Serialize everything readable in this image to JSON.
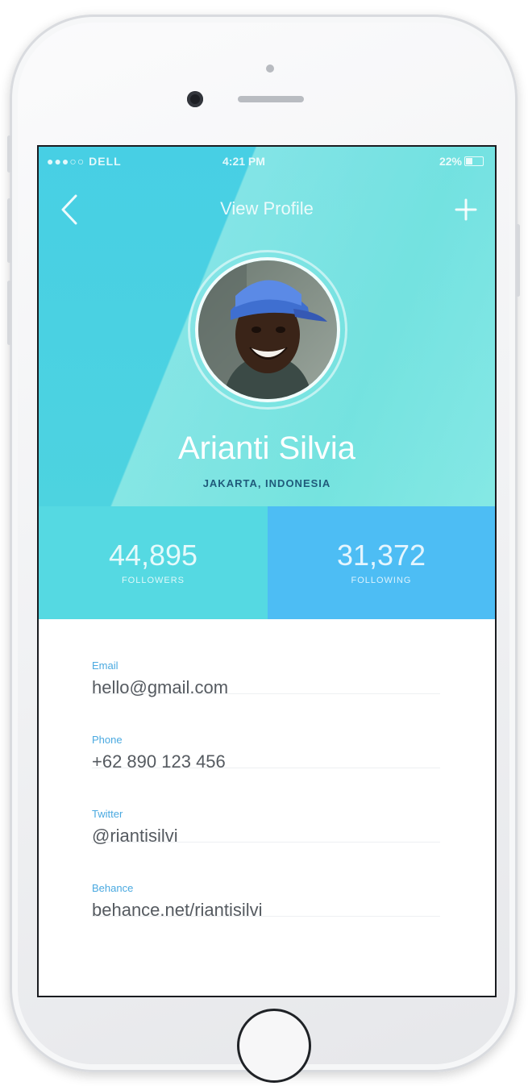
{
  "status_bar": {
    "carrier": "●●●○○ DELL",
    "time": "4:21 PM",
    "battery": "22%"
  },
  "nav": {
    "title": "View Profile",
    "back_icon": "chevron-left-icon",
    "add_icon": "plus-icon"
  },
  "profile": {
    "name": "Arianti Silvia",
    "location": "JAKARTA, INDONESIA"
  },
  "stats": {
    "followers_count": "44,895",
    "followers_label": "FOLLOWERS",
    "following_count": "31,372",
    "following_label": "FOLLOWING"
  },
  "contact": [
    {
      "label": "Email",
      "value": "hello@gmail.com"
    },
    {
      "label": "Phone",
      "value": "+62 890 123 456"
    },
    {
      "label": "Twitter",
      "value": "@riantisilvi"
    },
    {
      "label": "Behance",
      "value": "behance.net/riantisilvi"
    }
  ],
  "colors": {
    "hero": "#47cfe4",
    "followers_bg": "#55d9e2",
    "following_bg": "#4dbdf4",
    "label_accent": "#4aa9e0",
    "location_text": "#1f5a7a"
  }
}
